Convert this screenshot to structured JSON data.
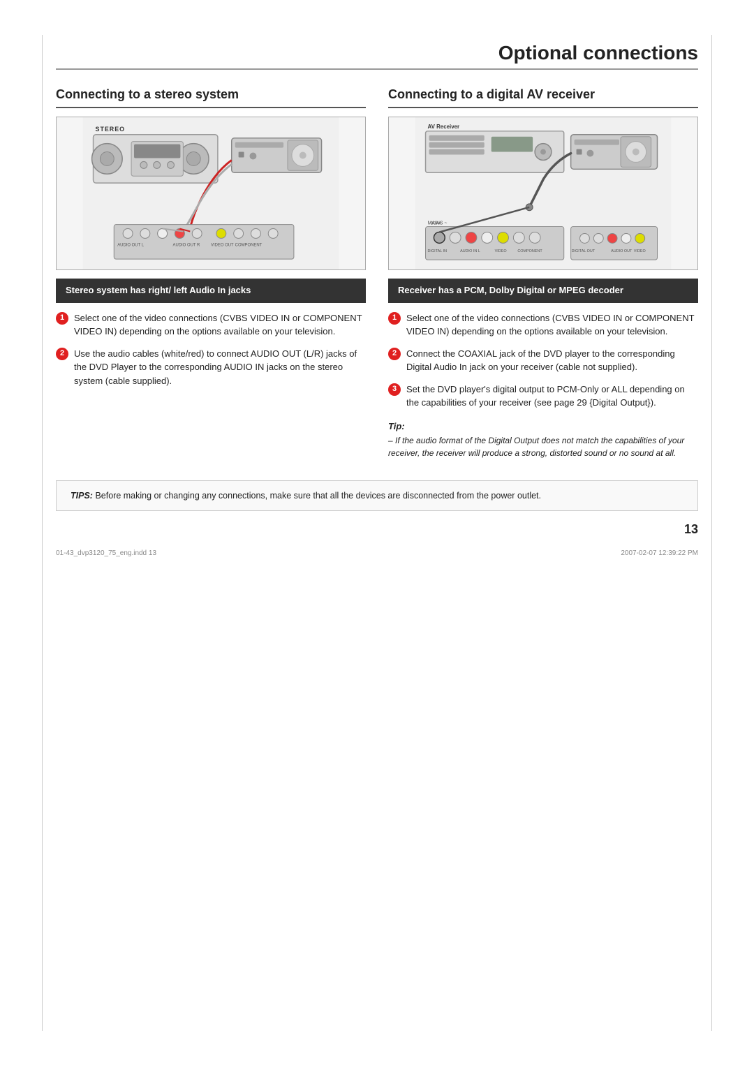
{
  "page": {
    "title": "Optional connections",
    "page_number": "13",
    "footer_left": "01-43_dvp3120_75_eng.indd  13",
    "footer_right": "2007-02-07  12:39:22 PM"
  },
  "tips_bottom": {
    "label": "TIPS:",
    "text": "Before making or changing any connections, make sure that all the devices are disconnected from the power outlet."
  },
  "left_col": {
    "section_title": "Connecting to a stereo system",
    "subheading": "Stereo system has right/ left Audio In jacks",
    "diagram_label": "STEREO",
    "steps": [
      {
        "num": "1",
        "text": "Select one of the video connections (CVBS VIDEO IN or COMPONENT VIDEO IN) depending on the options available on your television."
      },
      {
        "num": "2",
        "text": "Use the audio cables (white/red) to connect AUDIO OUT (L/R) jacks of the DVD Player to the corresponding AUDIO IN jacks on the stereo system (cable supplied)."
      }
    ]
  },
  "right_col": {
    "section_title": "Connecting to a digital AV receiver",
    "subheading": "Receiver has a PCM, Dolby Digital or MPEG decoder",
    "diagram_label": "AV Receiver",
    "steps": [
      {
        "num": "1",
        "text": "Select one of the video connections (CVBS VIDEO IN or COMPONENT VIDEO IN) depending on the options available on your television."
      },
      {
        "num": "2",
        "text": "Connect the COAXIAL jack of the DVD player to the corresponding Digital Audio In jack on your receiver (cable not supplied)."
      },
      {
        "num": "3",
        "text": "Set the DVD player's digital output to PCM-Only or ALL depending on the capabilities of your receiver (see page 29 {Digital Output})."
      }
    ],
    "tip": {
      "title": "Tip:",
      "text": "– If the audio format of the Digital Output does not match the capabilities of your receiver, the receiver will produce a strong, distorted sound or no sound at all."
    }
  }
}
